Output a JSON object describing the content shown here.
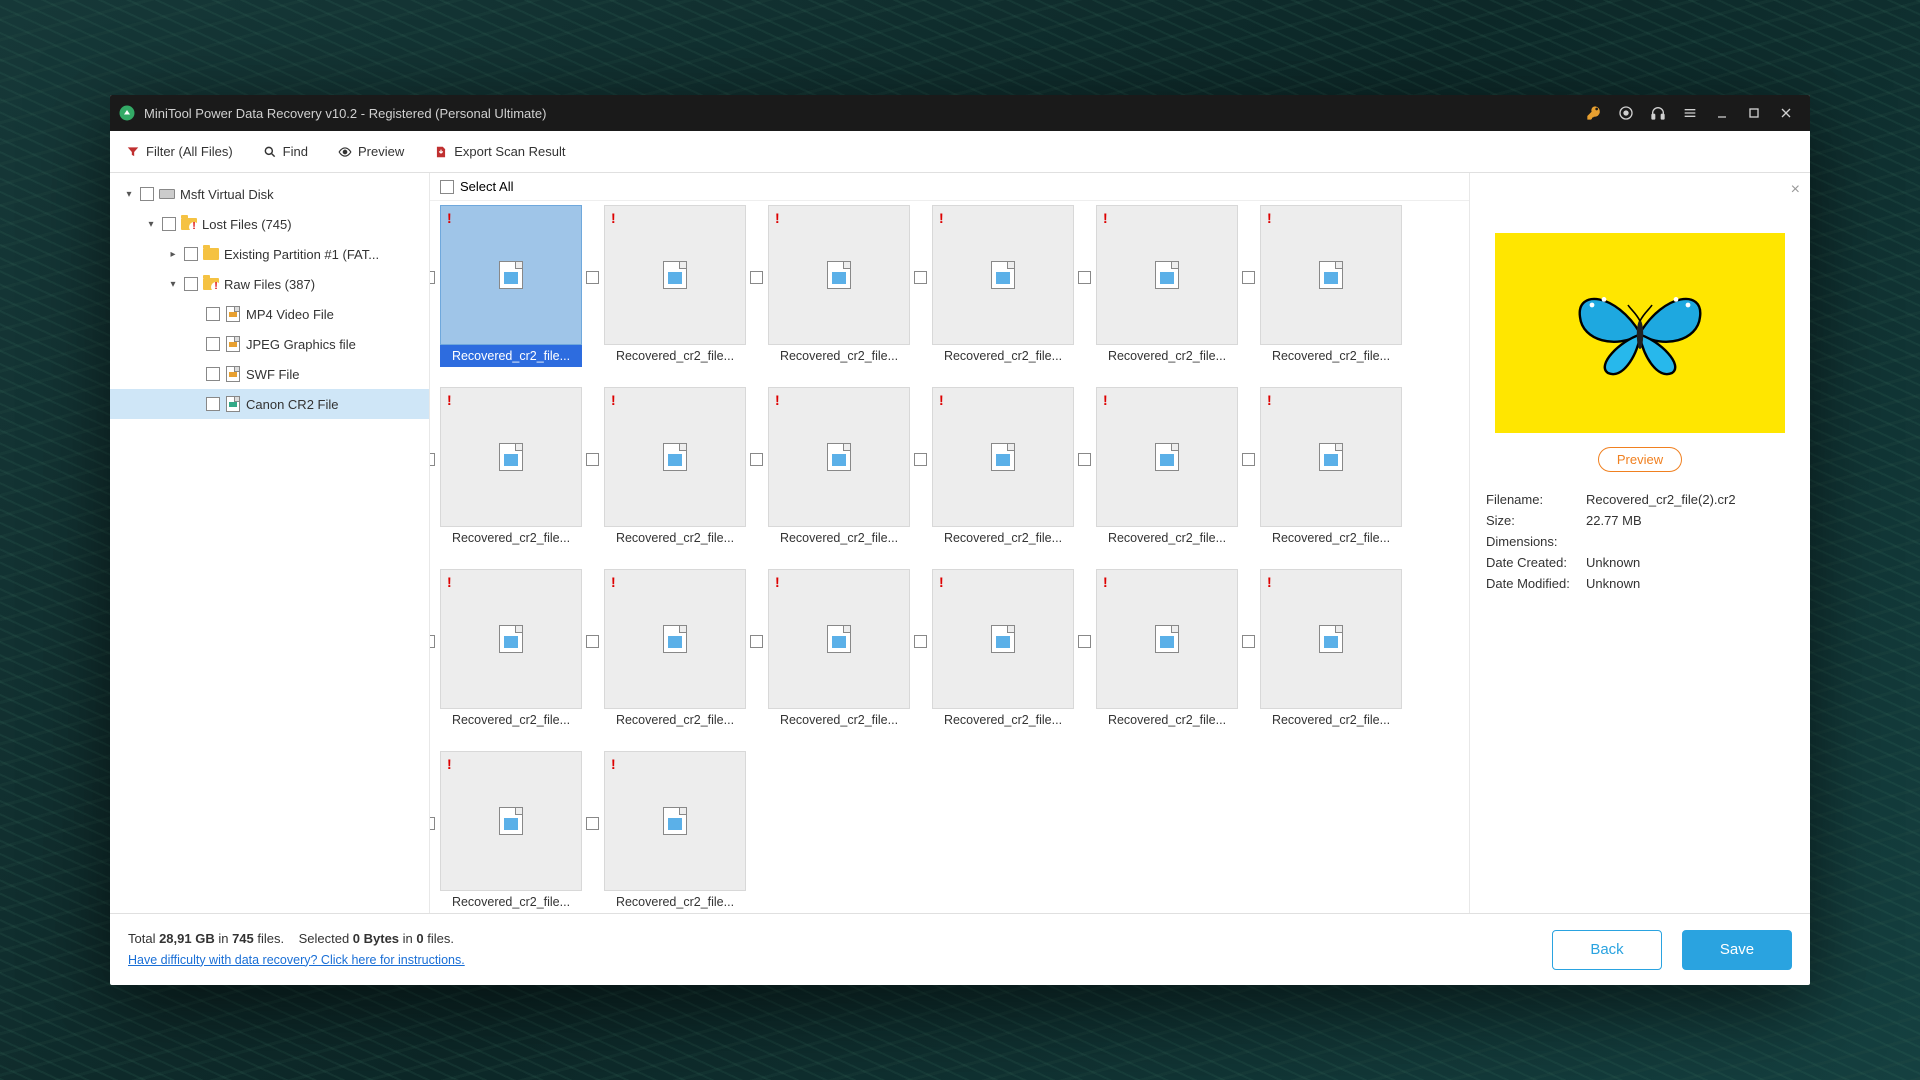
{
  "titlebar": {
    "title": "MiniTool Power Data Recovery v10.2 - Registered (Personal Ultimate)"
  },
  "toolbar": {
    "filter": "Filter (All Files)",
    "find": "Find",
    "preview": "Preview",
    "export": "Export Scan Result"
  },
  "tree": {
    "root": "Msft Virtual Disk",
    "lost": "Lost Files (745)",
    "part": "Existing Partition #1 (FAT...",
    "raw": "Raw Files (387)",
    "mp4": "MP4 Video File",
    "jpeg": "JPEG Graphics file",
    "swf": "SWF File",
    "cr2": "Canon CR2 File"
  },
  "main": {
    "selectall": "Select All",
    "file_label": "Recovered_cr2_file..."
  },
  "preview": {
    "button": "Preview",
    "filename_k": "Filename:",
    "filename_v": "Recovered_cr2_file(2).cr2",
    "size_k": "Size:",
    "size_v": "22.77 MB",
    "dim_k": "Dimensions:",
    "dim_v": "",
    "created_k": "Date Created:",
    "created_v": "Unknown",
    "modified_k": "Date Modified:",
    "modified_v": "Unknown"
  },
  "footer": {
    "total_pre": "Total ",
    "total_size": "28,91 GB",
    "total_mid": " in ",
    "total_files": "745",
    "total_post": " files.",
    "sel_pre": "Selected ",
    "sel_bytes": "0 Bytes",
    "sel_mid": " in ",
    "sel_count": "0",
    "sel_post": " files.",
    "help": "Have difficulty with data recovery? Click here for instructions.",
    "back": "Back",
    "save": "Save"
  }
}
